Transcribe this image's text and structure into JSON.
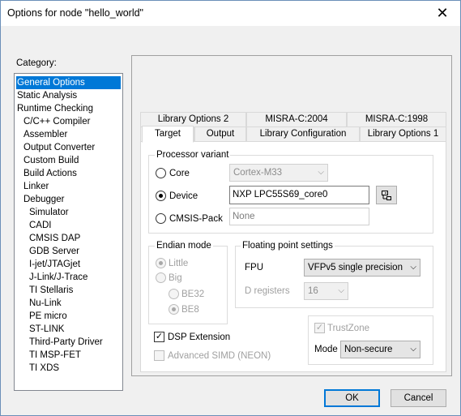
{
  "window": {
    "title": "Options for node \"hello_world\"",
    "close": "✕"
  },
  "category": {
    "label": "Category:",
    "items": [
      "General Options",
      "Static Analysis",
      "Runtime Checking",
      "C/C++ Compiler",
      "Assembler",
      "Output Converter",
      "Custom Build",
      "Build Actions",
      "Linker",
      "Debugger",
      "Simulator",
      "CADI",
      "CMSIS DAP",
      "GDB Server",
      "I-jet/JTAGjet",
      "J-Link/J-Trace",
      "TI Stellaris",
      "Nu-Link",
      "PE micro",
      "ST-LINK",
      "Third-Party Driver",
      "TI MSP-FET",
      "TI XDS"
    ],
    "selected": "General Options"
  },
  "tabs": {
    "row_back": [
      "Library Options 2",
      "MISRA-C:2004",
      "MISRA-C:1998"
    ],
    "row_front": [
      "Target",
      "Output",
      "Library Configuration",
      "Library Options 1"
    ],
    "active": "Target"
  },
  "processor": {
    "title": "Processor variant",
    "core_label": "Core",
    "core_value": "Cortex-M33",
    "device_label": "Device",
    "device_value": "NXP LPC55S69_core0",
    "cmsis_label": "CMSIS-Pack",
    "cmsis_value": "None",
    "selected": "Device"
  },
  "endian": {
    "title": "Endian mode",
    "little": "Little",
    "big": "Big",
    "be32": "BE32",
    "be8": "BE8"
  },
  "fp": {
    "title": "Floating point settings",
    "fpu_label": "FPU",
    "fpu_value": "VFPv5 single precision",
    "dreg_label": "D registers",
    "dreg_value": "16"
  },
  "dsp": {
    "label": "DSP Extension",
    "checked": true
  },
  "simd": {
    "label": "Advanced SIMD (NEON)",
    "checked": false
  },
  "trustzone": {
    "label": "TrustZone",
    "checked": true,
    "mode_label": "Mode",
    "mode_value": "Non-secure"
  },
  "buttons": {
    "ok": "OK",
    "cancel": "Cancel"
  }
}
